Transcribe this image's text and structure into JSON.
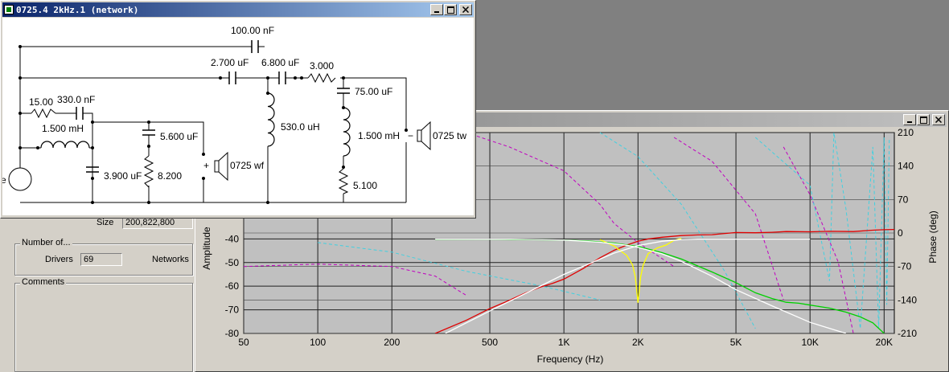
{
  "schematic_window": {
    "title": "0725.4  2kHz.1 (network)",
    "source_label": "e",
    "components": {
      "c_top": "100.00 nF",
      "c_a": "2.700 uF",
      "c_b": "6.800 uF",
      "r_series": "3.000",
      "c_shunt_tw": "75.00 uF",
      "l_tw": "1.500 mH",
      "r_tw": "5.100",
      "r_zobel": "15.00",
      "c_zobel": "330.0 nF",
      "l_main": "1.500 mH",
      "c_shunt": "3.900 uF",
      "c_wf": "5.600 uF",
      "r_wf": "8.200",
      "l_530": "530.0 uH"
    },
    "drivers": {
      "woofer": "0725 wf",
      "tweeter": "0725 tw",
      "woofer_plus": "+",
      "tweeter_minus": "−"
    }
  },
  "info_panel": {
    "size_label": "Size",
    "size_value": "200,822,800",
    "number_group": "Number of...",
    "drivers_label": "Drivers",
    "drivers_value": "69",
    "networks_label": "Networks",
    "comments_group": "Comments"
  },
  "chart_window": {
    "y_left_label": "Amplitude",
    "y_right_label": "Phase (deg)",
    "x_label": "Frequency (Hz)"
  },
  "chart_data": {
    "type": "line",
    "xscale": "log",
    "xlim": [
      50,
      22000
    ],
    "ylim_left": [
      -80,
      5
    ],
    "ylim_right": [
      -210,
      210
    ],
    "x_ticks": [
      50,
      100,
      200,
      500,
      1000,
      2000,
      5000,
      10000,
      20000
    ],
    "x_tick_labels": [
      "50",
      "100",
      "200",
      "500",
      "1K",
      "2K",
      "5K",
      "10K",
      "20K"
    ],
    "y_left_ticks": [
      -80,
      -70,
      -60,
      -50,
      -40
    ],
    "y_right_ticks": [
      -210,
      -140,
      -70,
      0,
      70,
      140,
      210
    ],
    "grid": true,
    "series_colors": {
      "tweeter": "#e00000",
      "woofer": "#00d000",
      "sum": "#ffff00",
      "target_lp": "#ffffff",
      "target_hp": "#ffffff",
      "phase_a": "#c000c0",
      "phase_b": "#40d0e0"
    },
    "series": [
      {
        "id": "tweeter",
        "x": [
          300,
          400,
          500,
          600,
          700,
          800,
          900,
          1000,
          1200,
          1400,
          1600,
          1800,
          2000,
          2200,
          2500,
          3000,
          3500,
          4000,
          5000,
          6000,
          7000,
          8000,
          10000,
          12000,
          15000,
          18000,
          20000,
          22000
        ],
        "y": [
          -80,
          -74.5,
          -69.5,
          -66,
          -62.8,
          -60.4,
          -58.8,
          -57,
          -52.5,
          -48,
          -44.8,
          -42.6,
          -41,
          -40,
          -39.3,
          -38.6,
          -38.3,
          -38.2,
          -37.3,
          -37.4,
          -37.2,
          -36.9,
          -37,
          -36.8,
          -36.9,
          -36.3,
          -36.1,
          -36.0
        ]
      },
      {
        "id": "woofer",
        "x": [
          300,
          500,
          700,
          1000,
          1300,
          1600,
          2000,
          2500,
          3000,
          4000,
          5000,
          6000,
          7000,
          8000,
          9000,
          10000,
          12000,
          14000,
          16000,
          18000,
          20000
        ],
        "y": [
          -40.2,
          -40.1,
          -40.3,
          -40.5,
          -41,
          -41.8,
          -43.2,
          -45.8,
          -48.5,
          -54,
          -58.5,
          -62.8,
          -65.2,
          -66.8,
          -67.2,
          -68,
          -69.3,
          -71,
          -73,
          -75.5,
          -80
        ]
      },
      {
        "id": "sum",
        "x": [
          1400,
          1600,
          1800,
          1900,
          1950,
          2000,
          2050,
          2100,
          2200,
          2400,
          2600,
          2800,
          3000
        ],
        "y": [
          -40.3,
          -43,
          -47,
          -51,
          -56,
          -67,
          -56,
          -51,
          -46.2,
          -43.8,
          -42.6,
          -40.6,
          -39.8
        ]
      },
      {
        "id": "target_hp",
        "x": [
          330,
          500,
          700,
          1000,
          1300,
          1600,
          2000,
          2500,
          3000,
          3500,
          4000,
          5000,
          7000,
          10000
        ],
        "y": [
          -80,
          -70.5,
          -63,
          -55,
          -50,
          -46,
          -42.8,
          -41,
          -40.3,
          -40.1,
          -40.1,
          -40.1,
          -40.1,
          -40.1
        ]
      },
      {
        "id": "target_lp",
        "x": [
          300,
          600,
          1000,
          1400,
          1800,
          2000,
          2500,
          3000,
          4000,
          5000,
          7000,
          10000,
          14000
        ],
        "y": [
          -40.1,
          -40.1,
          -40.5,
          -41.4,
          -42.7,
          -43.6,
          -46.3,
          -49.5,
          -55.8,
          -61.5,
          -68.3,
          -75.3,
          -80
        ]
      }
    ]
  }
}
